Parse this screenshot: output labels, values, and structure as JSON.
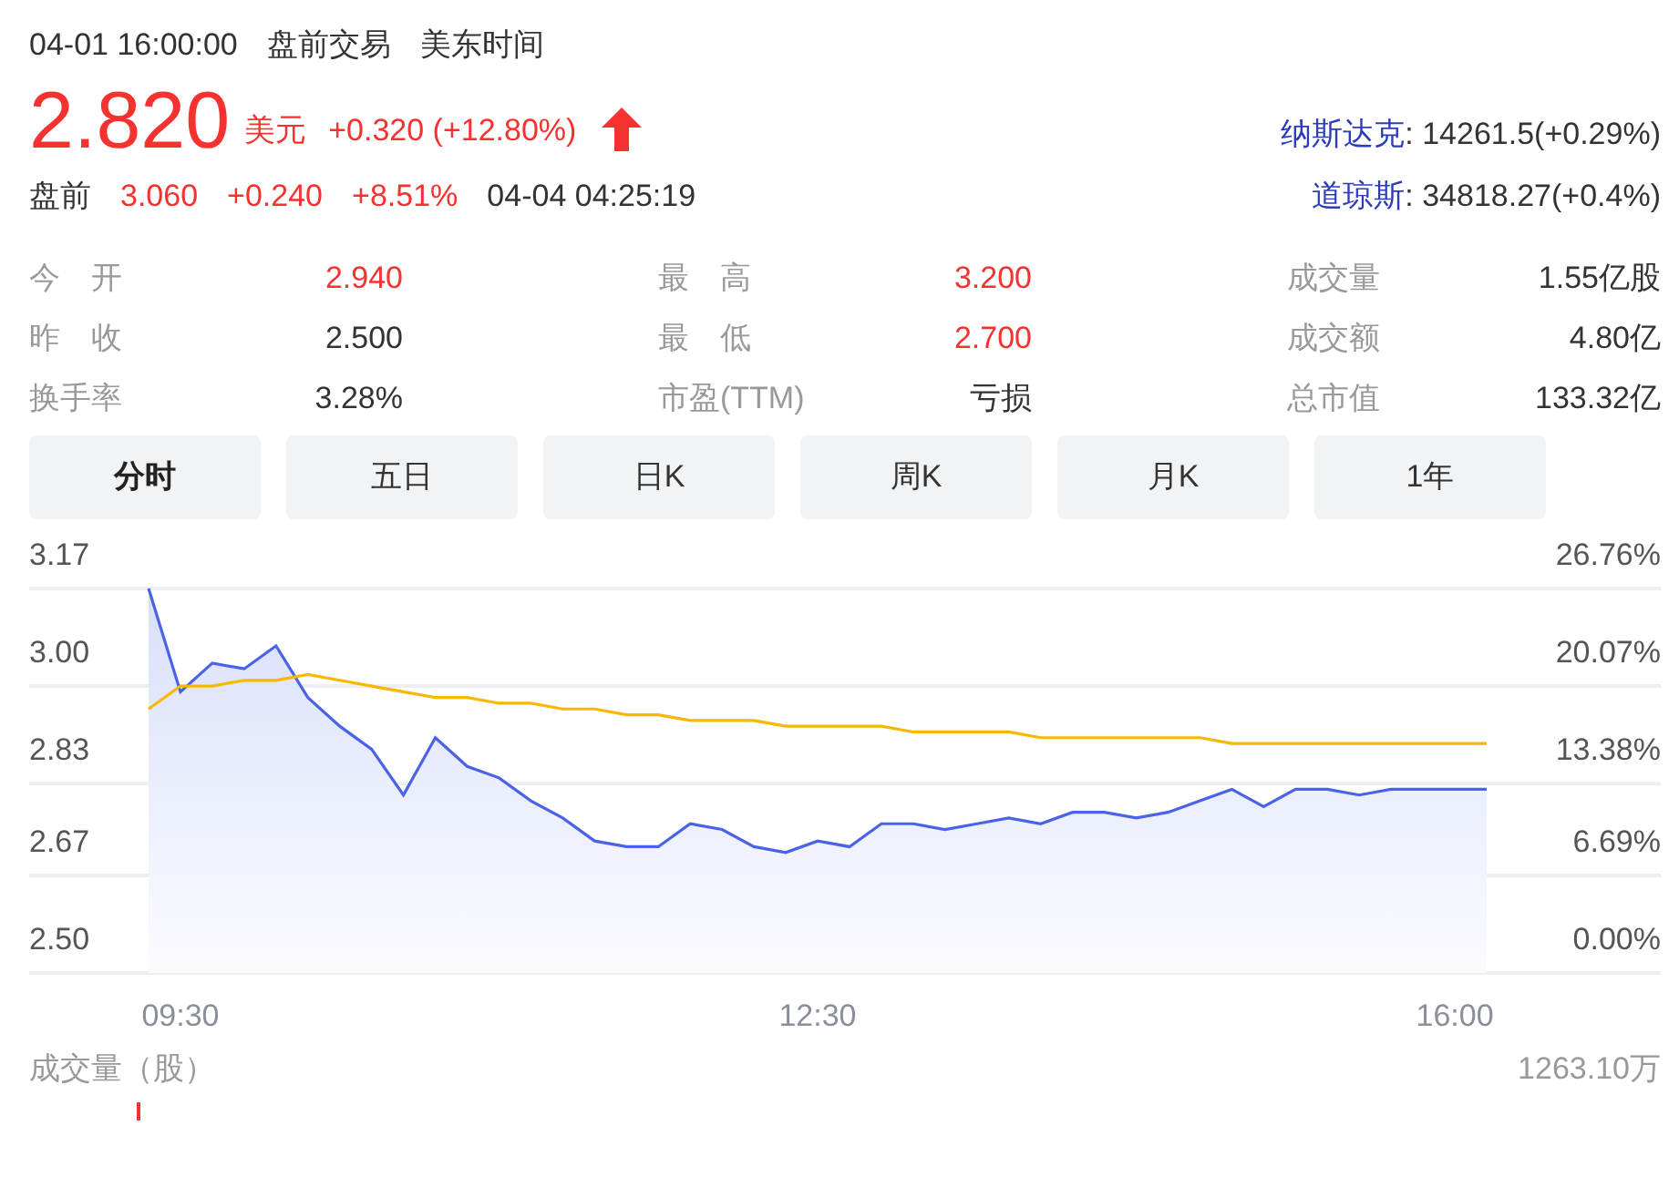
{
  "header": {
    "time": "04-01 16:00:00",
    "session": "盘前交易",
    "timezone": "美东时间"
  },
  "quote": {
    "price": "2.820",
    "currency": "美元",
    "change": "+0.320 (+12.80%)"
  },
  "premarket": {
    "label": "盘前",
    "price": "3.060",
    "change": "+0.240",
    "percent": "+8.51%",
    "time": "04-04 04:25:19"
  },
  "indices": [
    {
      "name": "纳斯达克",
      "value": ": 14261.5(+0.29%)"
    },
    {
      "name": "道琼斯",
      "value": ": 34818.27(+0.4%)"
    }
  ],
  "stats": [
    [
      {
        "label": "今 开",
        "value": "2.940",
        "color": "#f5322f"
      },
      {
        "label": "昨 收",
        "value": "2.500",
        "color": "#333333"
      },
      {
        "label": "换手率",
        "value": "3.28%",
        "color": "#333333"
      }
    ],
    [
      {
        "label": "最 高",
        "value": "3.200",
        "color": "#f5322f"
      },
      {
        "label": "最 低",
        "value": "2.700",
        "color": "#f5322f"
      },
      {
        "label": "市盈(TTM)",
        "value": "亏损",
        "color": "#333333"
      }
    ],
    [
      {
        "label": "成交量",
        "value": "1.55亿股",
        "color": "#333333"
      },
      {
        "label": "成交额",
        "value": "4.80亿",
        "color": "#333333"
      },
      {
        "label": "总市值",
        "value": "133.32亿",
        "color": "#333333"
      }
    ]
  ],
  "tabs": [
    {
      "label": "分时",
      "selected": true
    },
    {
      "label": "五日",
      "selected": false
    },
    {
      "label": "日K",
      "selected": false
    },
    {
      "label": "周K",
      "selected": false
    },
    {
      "label": "月K",
      "selected": false
    },
    {
      "label": "1年",
      "selected": false
    }
  ],
  "chart": {
    "percent_ticks": [
      "26.76%",
      "20.07%",
      "13.38%",
      "6.69%",
      "0.00%"
    ],
    "chart_data": {
      "type": "line",
      "grid": true,
      "categories": [
        null,
        "09:30",
        null,
        null,
        null,
        null,
        null,
        null,
        null,
        null,
        null,
        null,
        null,
        null,
        null,
        null,
        null,
        null,
        null,
        null,
        null,
        "12:30",
        null,
        null,
        null,
        null,
        null,
        null,
        null,
        null,
        null,
        null,
        null,
        null,
        null,
        null,
        null,
        null,
        null,
        null,
        null,
        "16:00",
        null
      ],
      "series": [
        {
          "type": "area",
          "color": "#4a63e6",
          "values": [
            3.17,
            2.99,
            3.04,
            3.03,
            3.07,
            2.98,
            2.93,
            2.89,
            2.81,
            2.91,
            2.86,
            2.84,
            2.8,
            2.77,
            2.73,
            2.72,
            2.72,
            2.76,
            2.75,
            2.72,
            2.71,
            2.73,
            2.72,
            2.76,
            2.76,
            2.75,
            2.76,
            2.77,
            2.76,
            2.78,
            2.78,
            2.77,
            2.78,
            2.8,
            2.82,
            2.79,
            2.82,
            2.82,
            2.81,
            2.82,
            2.82,
            2.82,
            2.82
          ]
        },
        {
          "type": "line",
          "color": "#f6b900",
          "values": [
            2.96,
            3.0,
            3.0,
            3.01,
            3.01,
            3.02,
            3.01,
            3.0,
            2.99,
            2.98,
            2.98,
            2.97,
            2.97,
            2.96,
            2.96,
            2.95,
            2.95,
            2.94,
            2.94,
            2.94,
            2.93,
            2.93,
            2.93,
            2.93,
            2.92,
            2.92,
            2.92,
            2.92,
            2.91,
            2.91,
            2.91,
            2.91,
            2.91,
            2.91,
            2.9,
            2.9,
            2.9,
            2.9,
            2.9,
            2.9,
            2.9,
            2.9,
            2.9
          ]
        }
      ],
      "ylim": [
        2.5,
        3.17
      ],
      "yticks": [
        {
          "value": 3.17,
          "label": "3.17"
        },
        {
          "value": 3.0,
          "label": "3.00"
        },
        {
          "value": 2.83,
          "label": "2.83"
        },
        {
          "value": 2.67,
          "label": "2.67"
        },
        {
          "value": 2.5,
          "label": "2.50"
        }
      ]
    }
  },
  "volume": {
    "label": "成交量（股）",
    "max": "1263.10万"
  }
}
